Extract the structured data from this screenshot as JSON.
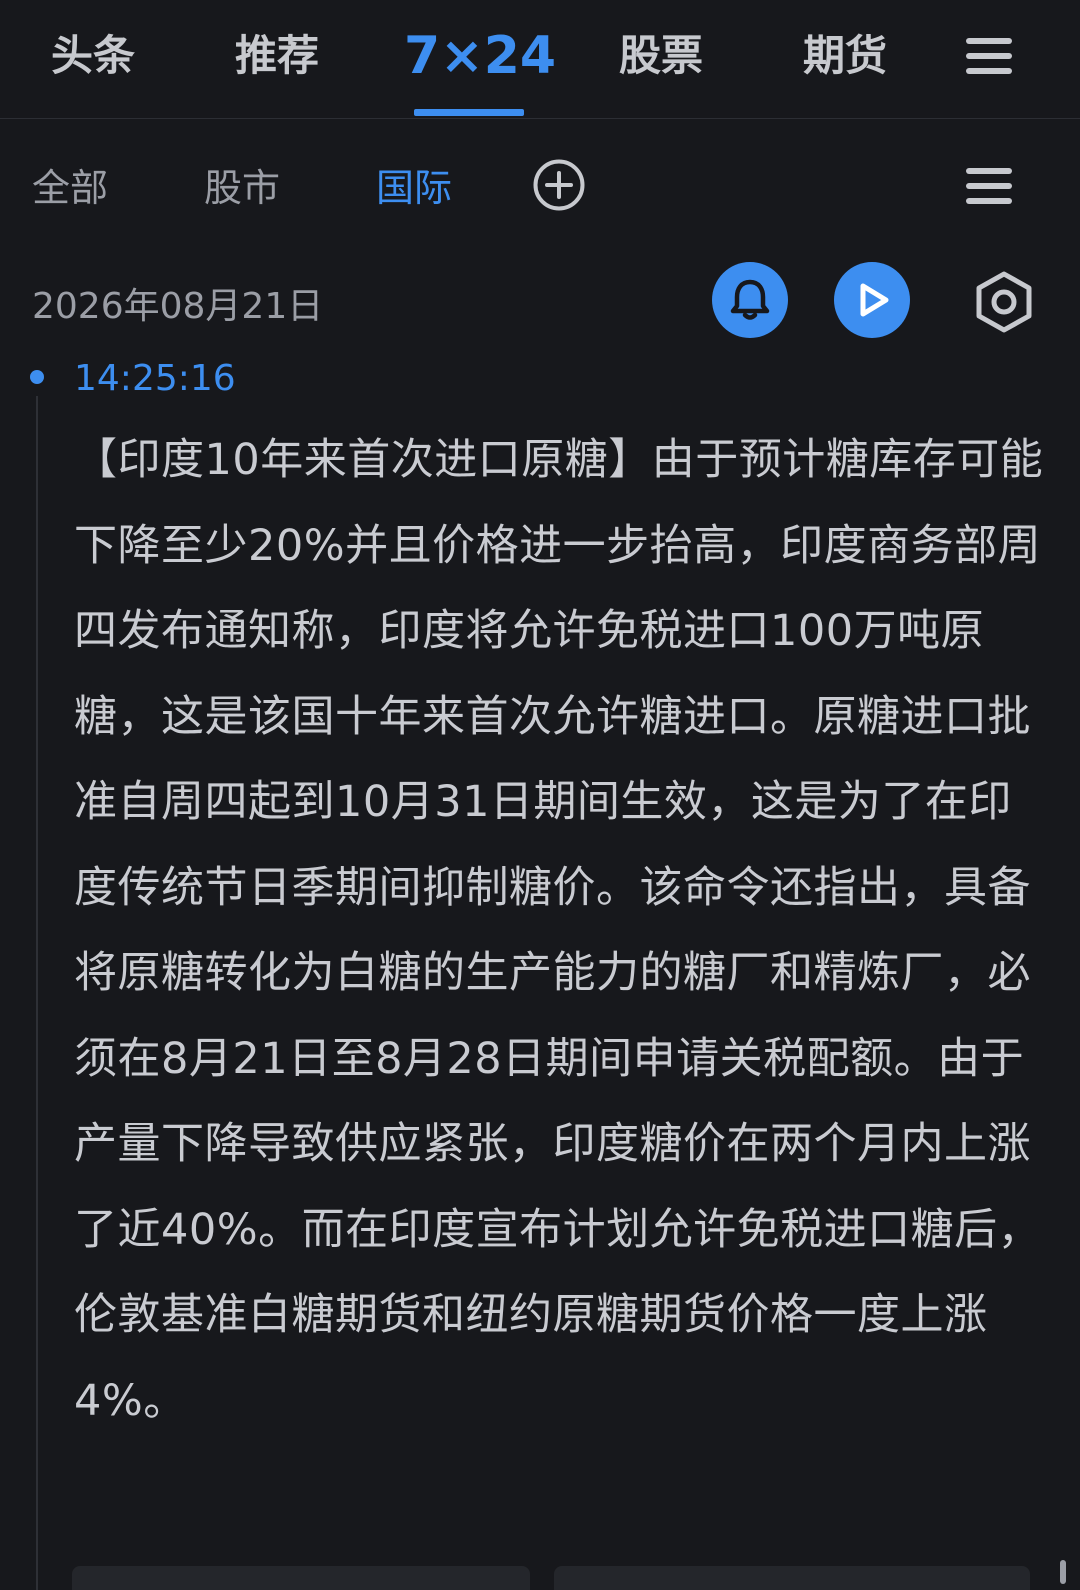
{
  "topnav": {
    "tabs": [
      {
        "label": "头条"
      },
      {
        "label": "推荐"
      },
      {
        "label": "7×24"
      },
      {
        "label": "股票"
      },
      {
        "label": "期货"
      }
    ]
  },
  "subnav": {
    "tabs": [
      {
        "label": "全部"
      },
      {
        "label": "股市"
      },
      {
        "label": "国际"
      }
    ]
  },
  "feed": {
    "date": "2026年08月21日",
    "item": {
      "time": "14:25:16",
      "content": "【印度10年来首次进口原糖】由于预计糖库存可能下降至少20%并且价格进一步抬高，印度商务部周四发布通知称，印度将允许免税进口100万吨原糖，这是该国十年来首次允许糖进口。原糖进口批准自周四起到10月31日期间生效，这是为了在印度传统节日季期间抑制糖价。该命令还指出，具备将原糖转化为白糖的生产能力的糖厂和精炼厂，必须在8月21日至8月28日期间申请关税配额。由于产量下降导致供应紧张，印度糖价在两个月内上涨了近40%。而在印度宣布计划允许免税进口糖后，伦敦基准白糖期货和纽约原糖期货价格一度上涨4%。"
    }
  },
  "colors": {
    "background": "#17181c",
    "accent": "#3d8ef0",
    "text": "#c9cbd1",
    "muted": "#9b9ea6"
  },
  "icons": [
    "menu-icon",
    "add-icon",
    "bell-icon",
    "play-icon",
    "settings-icon"
  ]
}
